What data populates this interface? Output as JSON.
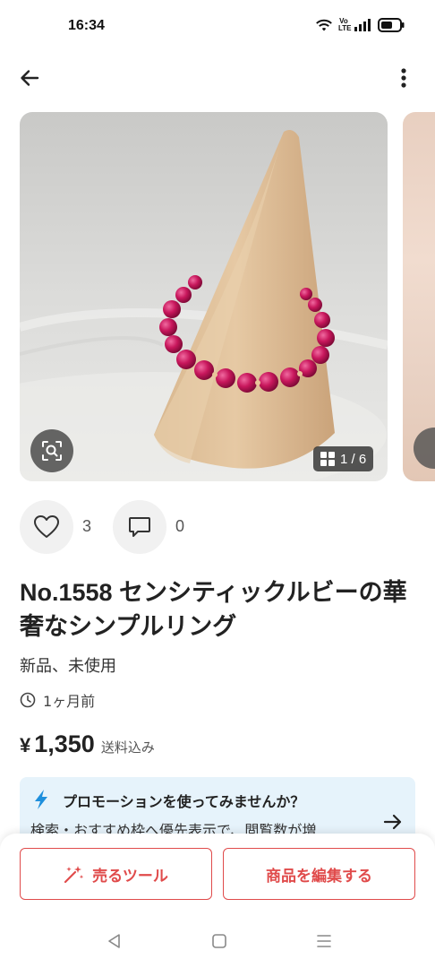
{
  "status_bar": {
    "time": "16:34",
    "volte": "Vo\nLTE"
  },
  "carousel": {
    "counter": "1 / 6"
  },
  "actions": {
    "likes": "3",
    "comments": "0"
  },
  "item": {
    "title": "No.1558  センシティックルビーの華奢なシンプルリング",
    "condition": "新品、未使用",
    "posted": "1ヶ月前",
    "price_symbol": "¥",
    "price": "1,350",
    "shipping": "送料込み"
  },
  "promotion": {
    "title": "プロモーションを使ってみませんか？",
    "body": "検索・おすすめ枠へ優先表示で、閲覧数が増"
  },
  "buttons": {
    "sell_tools": "売るツール",
    "edit_item": "商品を編集する"
  },
  "colors": {
    "accent": "#e04b4b",
    "promo_bg": "#e6f3fb",
    "bolt": "#1e8fdc"
  }
}
